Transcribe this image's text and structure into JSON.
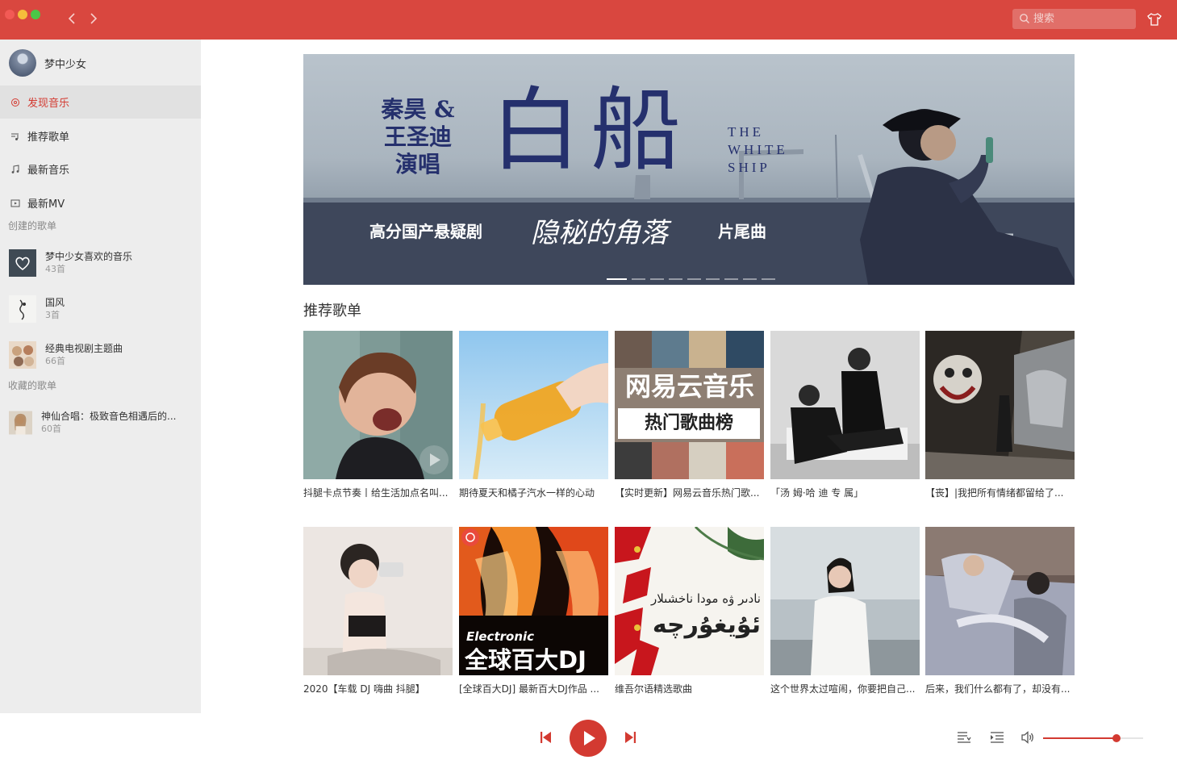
{
  "window": {
    "accent": "#d9473f",
    "active_color": "#d33a31"
  },
  "search": {
    "placeholder": "搜索"
  },
  "user": {
    "name": "梦中少女"
  },
  "menu": [
    {
      "label": "发现音乐",
      "icon": "discover-icon",
      "active": true
    },
    {
      "label": "推荐歌单",
      "icon": "playlist-icon",
      "active": false
    },
    {
      "label": "最新音乐",
      "icon": "music-note-icon",
      "active": false
    },
    {
      "label": "最新MV",
      "icon": "mv-icon",
      "active": false
    }
  ],
  "created_title": "创建的歌单",
  "created": [
    {
      "name": "梦中少女喜欢的音乐",
      "count": "43首"
    },
    {
      "name": "国风",
      "count": "3首"
    },
    {
      "name": "经典电视剧主题曲",
      "count": "66首"
    }
  ],
  "collected_title": "收藏的歌单",
  "collected": [
    {
      "name": "神仙合唱：极致音色相遇后的...",
      "count": "60首"
    }
  ],
  "banner": {
    "artists": "秦昊 & 王圣迪 演唱",
    "title_cn": "白船",
    "title_en": "THE WHITE SHIP",
    "tagline_left": "高分国产悬疑剧",
    "tagline_script": "隐秘的角落",
    "tagline_right": "片尾曲",
    "slides": 9,
    "current_slide": 1
  },
  "recommend": {
    "title": "推荐歌单",
    "cards": [
      {
        "caption": "抖腿卡点节奏丨给生活加点名叫...",
        "cover": "child-photo"
      },
      {
        "caption": "期待夏天和橘子汽水一样的心动",
        "cover": "orange-soda"
      },
      {
        "caption": "【实时更新】网易云音乐热门歌...",
        "cover": "hot-chart",
        "overlay_top": "网易云音乐",
        "overlay_bottom": "热门歌曲榜"
      },
      {
        "caption": "「汤 姆·哈 迪 专 属」",
        "cover": "bw-men"
      },
      {
        "caption": "【丧】|我把所有情绪都留给了...",
        "cover": "joker-wall"
      },
      {
        "caption": "2020【车载 DJ 嗨曲 抖腿】",
        "cover": "girl-selfie"
      },
      {
        "caption": "[全球百大DJ] 最新百大DJ作品 ...",
        "cover": "dj-flames",
        "overlay_small": "Electronic",
        "overlay_big": "全球百大DJ"
      },
      {
        "caption": "维吾尔语精选歌曲",
        "cover": "uyghur-flowers",
        "overlay_line1": "نادىر ۋە مودا ناخشىلار",
        "overlay_line2": "ئۇيغۇرچە"
      },
      {
        "caption": "这个世界太过喧闹，你要把自己...",
        "cover": "woman-white-shirt"
      },
      {
        "caption": "后来，我们什么都有了，却没有...",
        "cover": "couple-bed"
      }
    ]
  },
  "player": {
    "volume_percent": 73
  }
}
